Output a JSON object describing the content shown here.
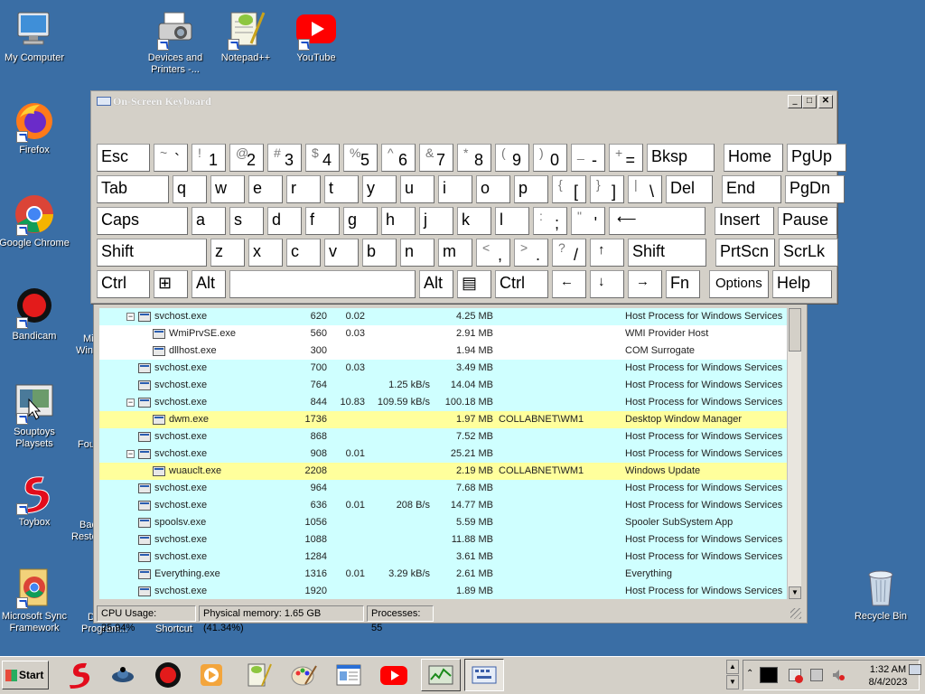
{
  "desktop": {
    "icons": [
      {
        "label": "My Computer"
      },
      {
        "label": "Devices and Printers -..."
      },
      {
        "label": "Notepad++"
      },
      {
        "label": "YouTube"
      },
      {
        "label": "Firefox"
      },
      {
        "label": "Google Chrome"
      },
      {
        "label": "Bandicam"
      },
      {
        "label": "Souptoys Playsets"
      },
      {
        "label": "Toybox"
      },
      {
        "label": "Microsoft Sync Framework"
      },
      {
        "label": "Recycle Bin"
      }
    ],
    "partial_labels": [
      "Mi",
      "Win",
      "Fou",
      "Bac",
      "Resto",
      "D",
      "Program...",
      "Shortcut"
    ]
  },
  "osk": {
    "title": "On-Screen Keyboard",
    "rows": [
      [
        {
          "label": "Esc"
        },
        {
          "shift": "~",
          "base": "`"
        },
        {
          "shift": "!",
          "base": "1"
        },
        {
          "shift": "@",
          "base": "2"
        },
        {
          "shift": "#",
          "base": "3"
        },
        {
          "shift": "$",
          "base": "4"
        },
        {
          "shift": "%",
          "base": "5"
        },
        {
          "shift": "^",
          "base": "6"
        },
        {
          "shift": "&",
          "base": "7"
        },
        {
          "shift": "*",
          "base": "8"
        },
        {
          "shift": "(",
          "base": "9"
        },
        {
          "shift": ")",
          "base": "0"
        },
        {
          "shift": "_",
          "base": "-"
        },
        {
          "shift": "+",
          "base": "="
        },
        {
          "label": "Bksp"
        },
        {
          "label": "Home"
        },
        {
          "label": "PgUp"
        }
      ],
      [
        {
          "label": "Tab"
        },
        {
          "label": "q"
        },
        {
          "label": "w"
        },
        {
          "label": "e"
        },
        {
          "label": "r"
        },
        {
          "label": "t"
        },
        {
          "label": "y"
        },
        {
          "label": "u"
        },
        {
          "label": "i"
        },
        {
          "label": "o"
        },
        {
          "label": "p"
        },
        {
          "shift": "{",
          "base": "["
        },
        {
          "shift": "}",
          "base": "]"
        },
        {
          "shift": "|",
          "base": "\\"
        },
        {
          "label": "Del"
        },
        {
          "label": "End"
        },
        {
          "label": "PgDn"
        }
      ],
      [
        {
          "label": "Caps"
        },
        {
          "label": "a"
        },
        {
          "label": "s"
        },
        {
          "label": "d"
        },
        {
          "label": "f"
        },
        {
          "label": "g"
        },
        {
          "label": "h"
        },
        {
          "label": "j"
        },
        {
          "label": "k"
        },
        {
          "label": "l"
        },
        {
          "shift": ":",
          "base": ";"
        },
        {
          "shift": "\"",
          "base": "'"
        },
        {
          "label": "⟵"
        },
        {
          "label": "Insert"
        },
        {
          "label": "Pause"
        }
      ],
      [
        {
          "label": "Shift"
        },
        {
          "label": "z"
        },
        {
          "label": "x"
        },
        {
          "label": "c"
        },
        {
          "label": "v"
        },
        {
          "label": "b"
        },
        {
          "label": "n"
        },
        {
          "label": "m"
        },
        {
          "shift": "<",
          "base": ","
        },
        {
          "shift": ">",
          "base": "."
        },
        {
          "shift": "?",
          "base": "/"
        },
        {
          "label": "↑"
        },
        {
          "label": "Shift"
        },
        {
          "label": "PrtScn"
        },
        {
          "label": "ScrLk"
        }
      ],
      [
        {
          "label": "Ctrl"
        },
        {
          "label": "⊞"
        },
        {
          "label": "Alt"
        },
        {
          "label": ""
        },
        {
          "label": "Alt"
        },
        {
          "label": "▤"
        },
        {
          "label": "Ctrl"
        },
        {
          "label": "←"
        },
        {
          "label": "↓"
        },
        {
          "label": "→"
        },
        {
          "label": "Fn"
        },
        {
          "label": "Options"
        },
        {
          "label": "Help"
        }
      ]
    ]
  },
  "processes": {
    "rows": [
      {
        "name": "svchost.exe",
        "pid": "620",
        "cpu": "0.02",
        "io": "",
        "mem": "4.25 MB",
        "user": "",
        "desc": "Host Process for Windows Services",
        "kind": "svc",
        "indent": 1,
        "toggle": "−"
      },
      {
        "name": "WmiPrvSE.exe",
        "pid": "560",
        "cpu": "0.03",
        "io": "",
        "mem": "2.91 MB",
        "user": "",
        "desc": "WMI Provider Host",
        "kind": "def",
        "indent": 2,
        "toggle": ""
      },
      {
        "name": "dllhost.exe",
        "pid": "300",
        "cpu": "",
        "io": "",
        "mem": "1.94 MB",
        "user": "",
        "desc": "COM Surrogate",
        "kind": "def",
        "indent": 2,
        "toggle": ""
      },
      {
        "name": "svchost.exe",
        "pid": "700",
        "cpu": "0.03",
        "io": "",
        "mem": "3.49 MB",
        "user": "",
        "desc": "Host Process for Windows Services",
        "kind": "svc",
        "indent": 1,
        "toggle": ""
      },
      {
        "name": "svchost.exe",
        "pid": "764",
        "cpu": "",
        "io": "1.25 kB/s",
        "mem": "14.04 MB",
        "user": "",
        "desc": "Host Process for Windows Services",
        "kind": "svc",
        "indent": 1,
        "toggle": ""
      },
      {
        "name": "svchost.exe",
        "pid": "844",
        "cpu": "10.83",
        "io": "109.59 kB/s",
        "mem": "100.18 MB",
        "user": "",
        "desc": "Host Process for Windows Services",
        "kind": "svc",
        "indent": 1,
        "toggle": "−"
      },
      {
        "name": "dwm.exe",
        "pid": "1736",
        "cpu": "",
        "io": "",
        "mem": "1.97 MB",
        "user": "COLLABNET\\WM1",
        "desc": "Desktop Window Manager",
        "kind": "usr",
        "indent": 2,
        "toggle": ""
      },
      {
        "name": "svchost.exe",
        "pid": "868",
        "cpu": "",
        "io": "",
        "mem": "7.52 MB",
        "user": "",
        "desc": "Host Process for Windows Services",
        "kind": "svc",
        "indent": 1,
        "toggle": ""
      },
      {
        "name": "svchost.exe",
        "pid": "908",
        "cpu": "0.01",
        "io": "",
        "mem": "25.21 MB",
        "user": "",
        "desc": "Host Process for Windows Services",
        "kind": "svc",
        "indent": 1,
        "toggle": "−"
      },
      {
        "name": "wuauclt.exe",
        "pid": "2208",
        "cpu": "",
        "io": "",
        "mem": "2.19 MB",
        "user": "COLLABNET\\WM1",
        "desc": "Windows Update",
        "kind": "usr",
        "indent": 2,
        "toggle": ""
      },
      {
        "name": "svchost.exe",
        "pid": "964",
        "cpu": "",
        "io": "",
        "mem": "7.68 MB",
        "user": "",
        "desc": "Host Process for Windows Services",
        "kind": "svc",
        "indent": 1,
        "toggle": ""
      },
      {
        "name": "svchost.exe",
        "pid": "636",
        "cpu": "0.01",
        "io": "208 B/s",
        "mem": "14.77 MB",
        "user": "",
        "desc": "Host Process for Windows Services",
        "kind": "svc",
        "indent": 1,
        "toggle": ""
      },
      {
        "name": "spoolsv.exe",
        "pid": "1056",
        "cpu": "",
        "io": "",
        "mem": "5.59 MB",
        "user": "",
        "desc": "Spooler SubSystem App",
        "kind": "svc",
        "indent": 1,
        "toggle": ""
      },
      {
        "name": "svchost.exe",
        "pid": "1088",
        "cpu": "",
        "io": "",
        "mem": "11.88 MB",
        "user": "",
        "desc": "Host Process for Windows Services",
        "kind": "svc",
        "indent": 1,
        "toggle": ""
      },
      {
        "name": "svchost.exe",
        "pid": "1284",
        "cpu": "",
        "io": "",
        "mem": "3.61 MB",
        "user": "",
        "desc": "Host Process for Windows Services",
        "kind": "svc",
        "indent": 1,
        "toggle": ""
      },
      {
        "name": "Everything.exe",
        "pid": "1316",
        "cpu": "0.01",
        "io": "3.29 kB/s",
        "mem": "2.61 MB",
        "user": "",
        "desc": "Everything",
        "kind": "svc",
        "indent": 1,
        "toggle": ""
      },
      {
        "name": "svchost.exe",
        "pid": "1920",
        "cpu": "",
        "io": "",
        "mem": "1.89 MB",
        "user": "",
        "desc": "Host Process for Windows Services",
        "kind": "svc",
        "indent": 1,
        "toggle": ""
      }
    ],
    "status": {
      "cpu": "CPU Usage: 25.94%",
      "memory": "Physical memory: 1.65 GB (41.34%)",
      "processes": "Processes: 55"
    }
  },
  "taskbar": {
    "start_label": "Start",
    "clock_time": "1:32 AM",
    "clock_date": "8/4/2023"
  },
  "colors": {
    "desktop": "#3a6ea5",
    "service_row": "#cfffff",
    "user_row": "#ffff9c"
  }
}
